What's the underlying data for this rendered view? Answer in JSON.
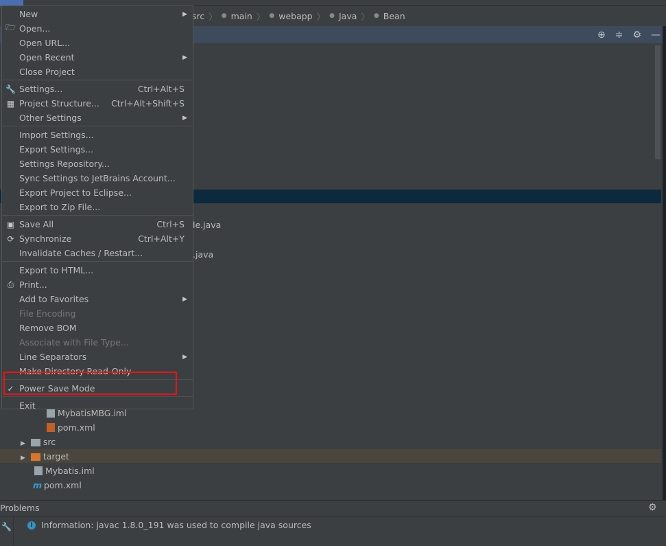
{
  "breadcrumb": [
    "src",
    "main",
    "webapp",
    "Java",
    "Bean"
  ],
  "tree": {
    "file1": "le.java",
    "file2": ".java",
    "mbg_iml": "MybatisMBG.iml",
    "pom1": "pom.xml",
    "src": "src",
    "target": "target",
    "mybatis_iml": "Mybatis.iml",
    "pom2": "pom.xml"
  },
  "problems": {
    "title": "Problems",
    "message": "Information: javac 1.8.0_191 was used to compile java sources"
  },
  "menu": [
    {
      "label": "New",
      "submenu": true
    },
    {
      "label": "Open...",
      "icon": "folder"
    },
    {
      "label": "Open URL..."
    },
    {
      "label": "Open Recent",
      "submenu": true
    },
    {
      "label": "Close Project"
    },
    {
      "sep": true
    },
    {
      "label": "Settings...",
      "icon": "wrench",
      "shortcut": "Ctrl+Alt+S"
    },
    {
      "label": "Project Structure...",
      "icon": "project-structure",
      "shortcut": "Ctrl+Alt+Shift+S"
    },
    {
      "label": "Other Settings",
      "submenu": true
    },
    {
      "sep": true
    },
    {
      "label": "Import Settings..."
    },
    {
      "label": "Export Settings..."
    },
    {
      "label": "Settings Repository..."
    },
    {
      "label": "Sync Settings to JetBrains Account..."
    },
    {
      "label": "Export Project to Eclipse..."
    },
    {
      "label": "Export to Zip File..."
    },
    {
      "sep": true
    },
    {
      "label": "Save All",
      "icon": "save",
      "shortcut": "Ctrl+S"
    },
    {
      "label": "Synchronize",
      "icon": "sync",
      "shortcut": "Ctrl+Alt+Y"
    },
    {
      "label": "Invalidate Caches / Restart..."
    },
    {
      "sep": true
    },
    {
      "label": "Export to HTML..."
    },
    {
      "label": "Print...",
      "icon": "print"
    },
    {
      "label": "Add to Favorites",
      "submenu": true
    },
    {
      "label": "File Encoding",
      "disabled": true
    },
    {
      "label": "Remove BOM"
    },
    {
      "label": "Associate with File Type...",
      "disabled": true
    },
    {
      "label": "Line Separators",
      "submenu": true
    },
    {
      "label": "Make Directory Read-Only"
    },
    {
      "sep": true
    },
    {
      "label": "Power Save Mode",
      "icon": "check",
      "checked": true
    },
    {
      "sep": true
    },
    {
      "label": "Exit"
    }
  ],
  "colors": {
    "highlight_box": "#e8141a",
    "selection": "#0d293e",
    "target_row": "#4a463d",
    "info": "#3592c4"
  }
}
